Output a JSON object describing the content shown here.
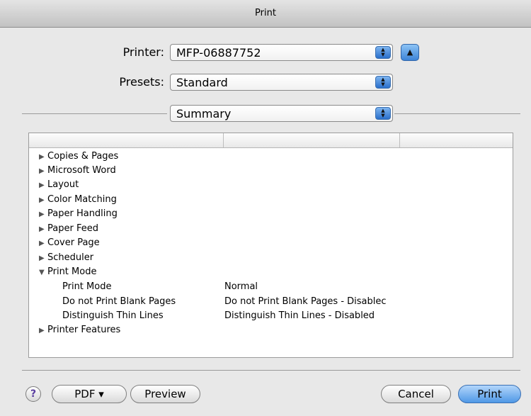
{
  "window": {
    "title": "Print"
  },
  "printer": {
    "label": "Printer:",
    "value": "MFP-06887752"
  },
  "presets": {
    "label": "Presets:",
    "value": "Standard"
  },
  "pane": {
    "value": "Summary"
  },
  "summary": {
    "rows": [
      {
        "label": "Copies & Pages",
        "expanded": false
      },
      {
        "label": "Microsoft Word",
        "expanded": false
      },
      {
        "label": "Layout",
        "expanded": false
      },
      {
        "label": "Color Matching",
        "expanded": false
      },
      {
        "label": "Paper Handling",
        "expanded": false
      },
      {
        "label": "Paper Feed",
        "expanded": false
      },
      {
        "label": "Cover Page",
        "expanded": false
      },
      {
        "label": "Scheduler",
        "expanded": false
      },
      {
        "label": "Print Mode",
        "expanded": true
      }
    ],
    "details": [
      {
        "name": "Print Mode",
        "value": "Normal"
      },
      {
        "name": "Do not Print Blank Pages",
        "value": "Do not Print Blank Pages - Disablec"
      },
      {
        "name": "Distinguish Thin Lines",
        "value": "Distinguish Thin Lines - Disabled"
      }
    ],
    "last_row": {
      "label": "Printer Features",
      "expanded": false
    }
  },
  "icons": {
    "collapsed": "▶",
    "expanded": "▼",
    "eject": "▲",
    "stepper_up": "▲",
    "stepper_down": "▼"
  },
  "buttons": {
    "help": "?",
    "pdf": "PDF ▾",
    "preview": "Preview",
    "cancel": "Cancel",
    "print": "Print"
  }
}
